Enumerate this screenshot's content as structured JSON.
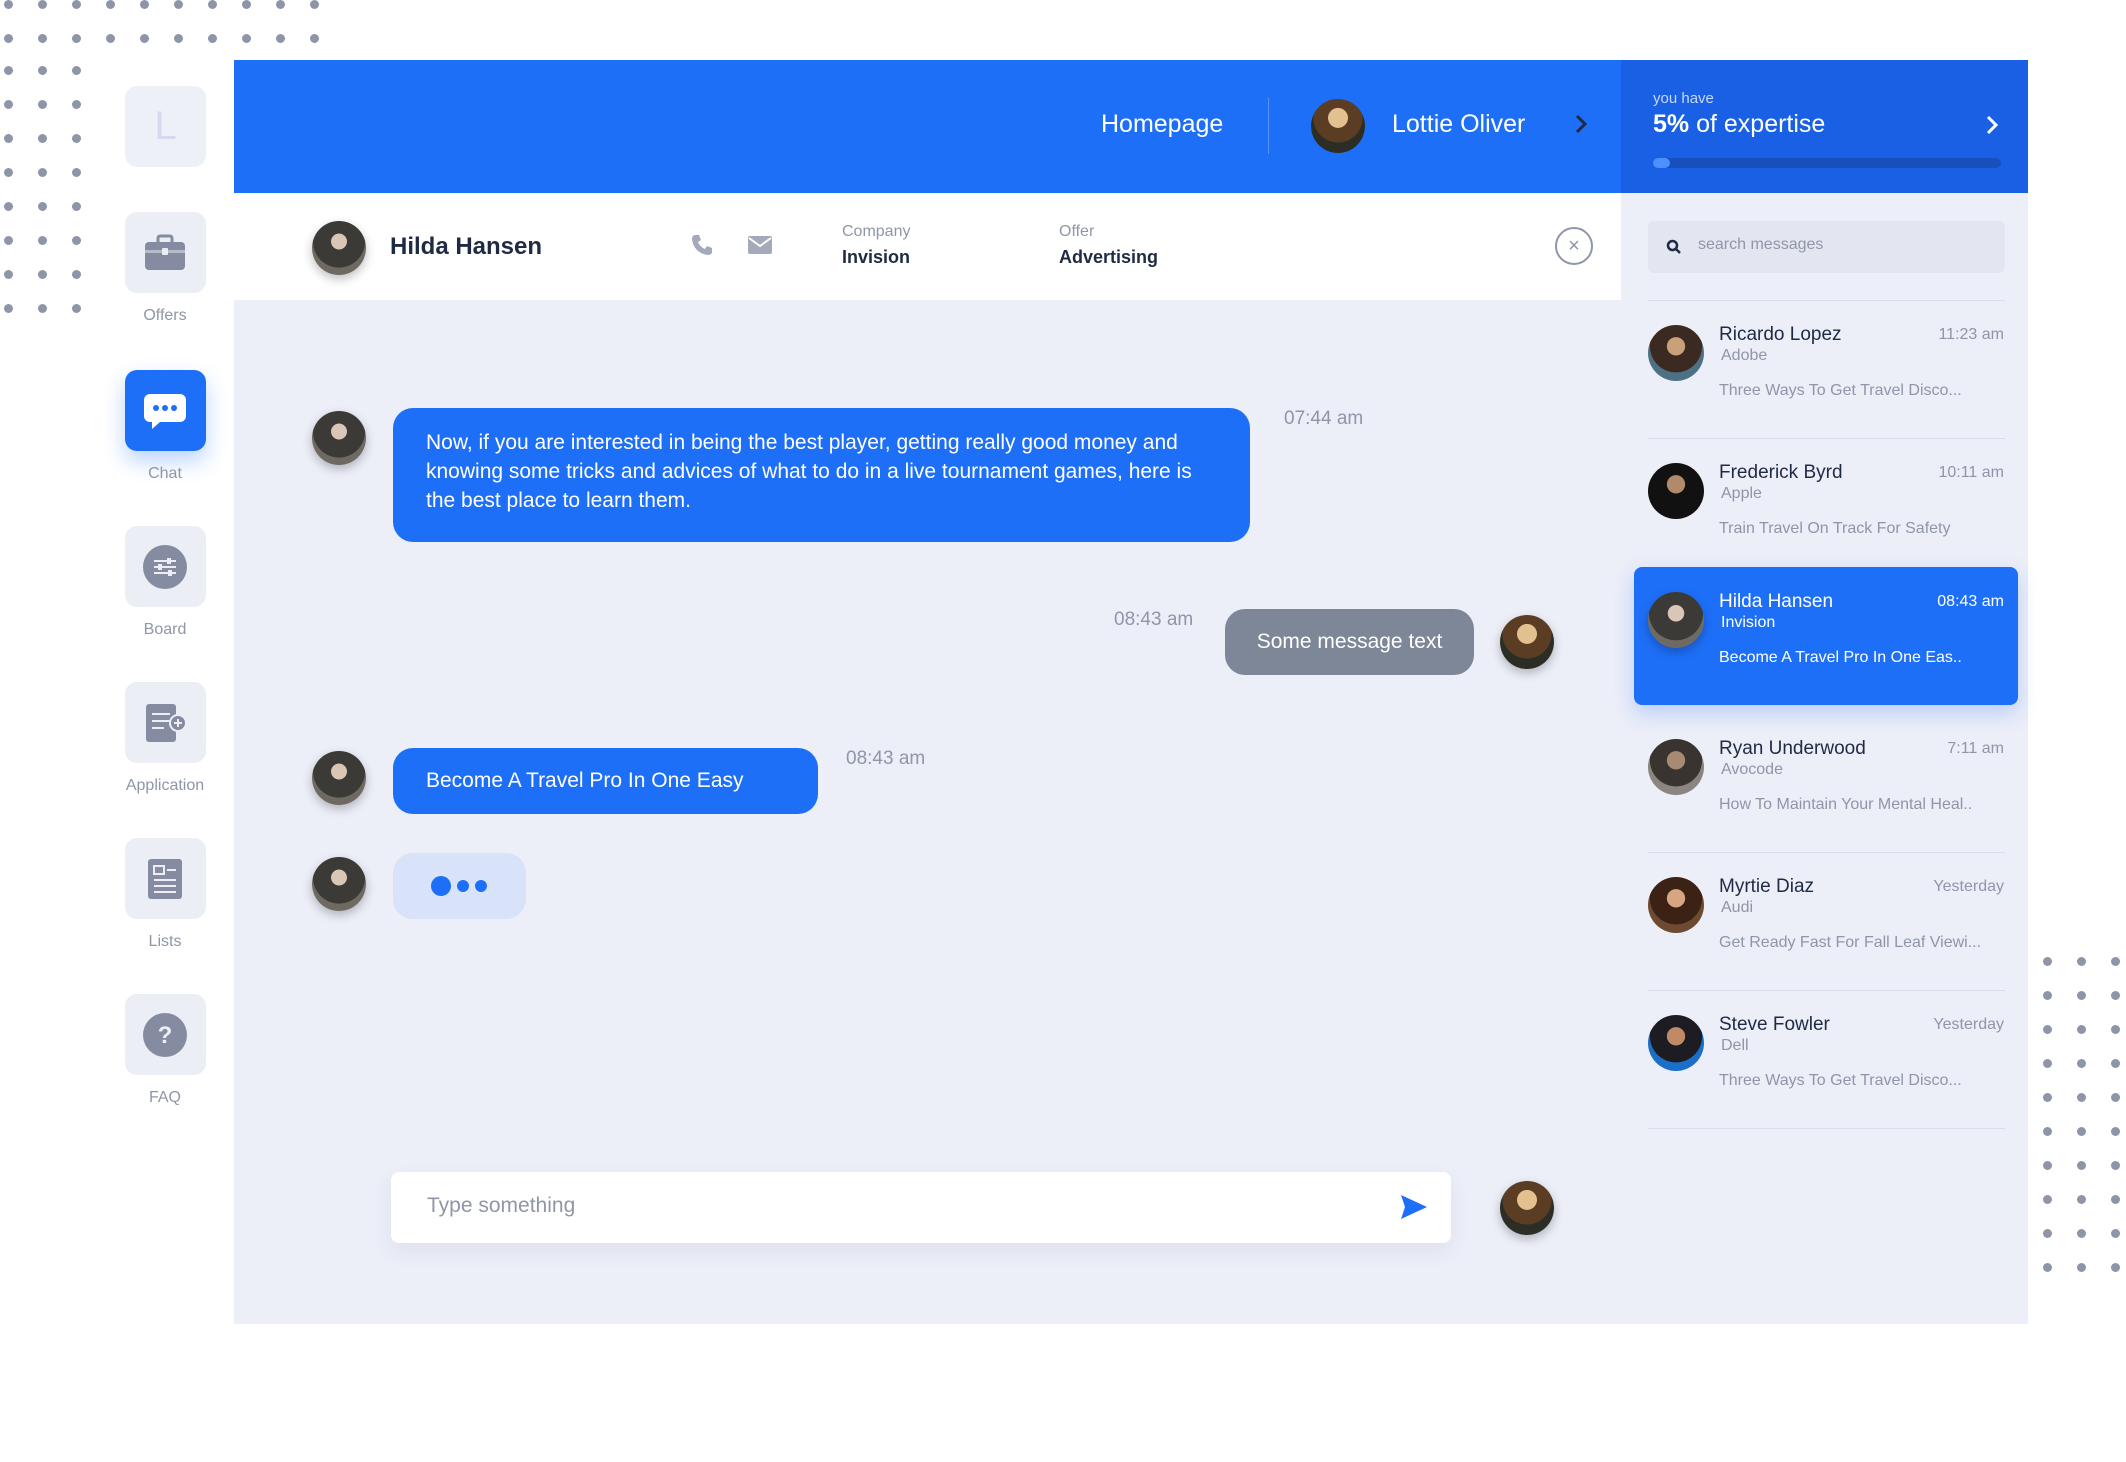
{
  "nav": {
    "logo_letter": "L",
    "items": [
      {
        "label": "Offers",
        "icon": "briefcase-icon"
      },
      {
        "label": "Chat",
        "icon": "chat-bubble-icon",
        "active": true
      },
      {
        "label": "Board",
        "icon": "sliders-icon"
      },
      {
        "label": "Application",
        "icon": "document-add-icon"
      },
      {
        "label": "Lists",
        "icon": "list-card-icon"
      },
      {
        "label": "FAQ",
        "icon": "question-icon"
      }
    ]
  },
  "header": {
    "homepage_label": "Homepage",
    "user_name": "Lottie Oliver"
  },
  "expertise": {
    "label": "you have",
    "percent": "5%",
    "suffix": " of expertise",
    "progress_fraction": 0.05
  },
  "contact": {
    "name": "Hilda Hansen",
    "company_label": "Company",
    "company": "Invision",
    "offer_label": "Offer",
    "offer": "Advertising"
  },
  "messages": [
    {
      "from": "them",
      "text": "Now, if you are interested in being the best player, getting really good money and knowing some tricks and advices of what to do in a live tournament games, here is the best place to learn them.",
      "time": "07:44 am"
    },
    {
      "from": "me",
      "text": "Some message text",
      "time": "08:43 am"
    },
    {
      "from": "them",
      "text": "Become A Travel Pro In One Easy",
      "time": "08:43 am"
    }
  ],
  "composer": {
    "placeholder": "Type something"
  },
  "search": {
    "placeholder": "search messages"
  },
  "conversations": [
    {
      "name": "Ricardo Lopez",
      "company": "Adobe",
      "time": "11:23 am",
      "preview": "Three Ways To Get Travel Disco..."
    },
    {
      "name": "Frederick Byrd",
      "company": "Apple",
      "time": "10:11 am",
      "preview": "Train Travel On Track For Safety"
    },
    {
      "name": "Hilda Hansen",
      "company": "Invision",
      "time": "08:43 am",
      "preview": "Become A Travel Pro In One Eas..",
      "active": true
    },
    {
      "name": "Ryan Underwood",
      "company": "Avocode",
      "time": "7:11 am",
      "preview": "How To Maintain Your Mental Heal.."
    },
    {
      "name": "Myrtie Diaz",
      "company": "Audi",
      "time": "Yesterday",
      "preview": "Get Ready Fast For Fall Leaf Viewi..."
    },
    {
      "name": "Steve Fowler",
      "company": "Dell",
      "time": "Yesterday",
      "preview": "Three Ways To Get Travel Disco..."
    }
  ],
  "colors": {
    "accent": "#1e6ff8",
    "sidebar_header": "#1960e4",
    "outgoing_bubble": "#7d8797",
    "background": "#eceef8"
  }
}
